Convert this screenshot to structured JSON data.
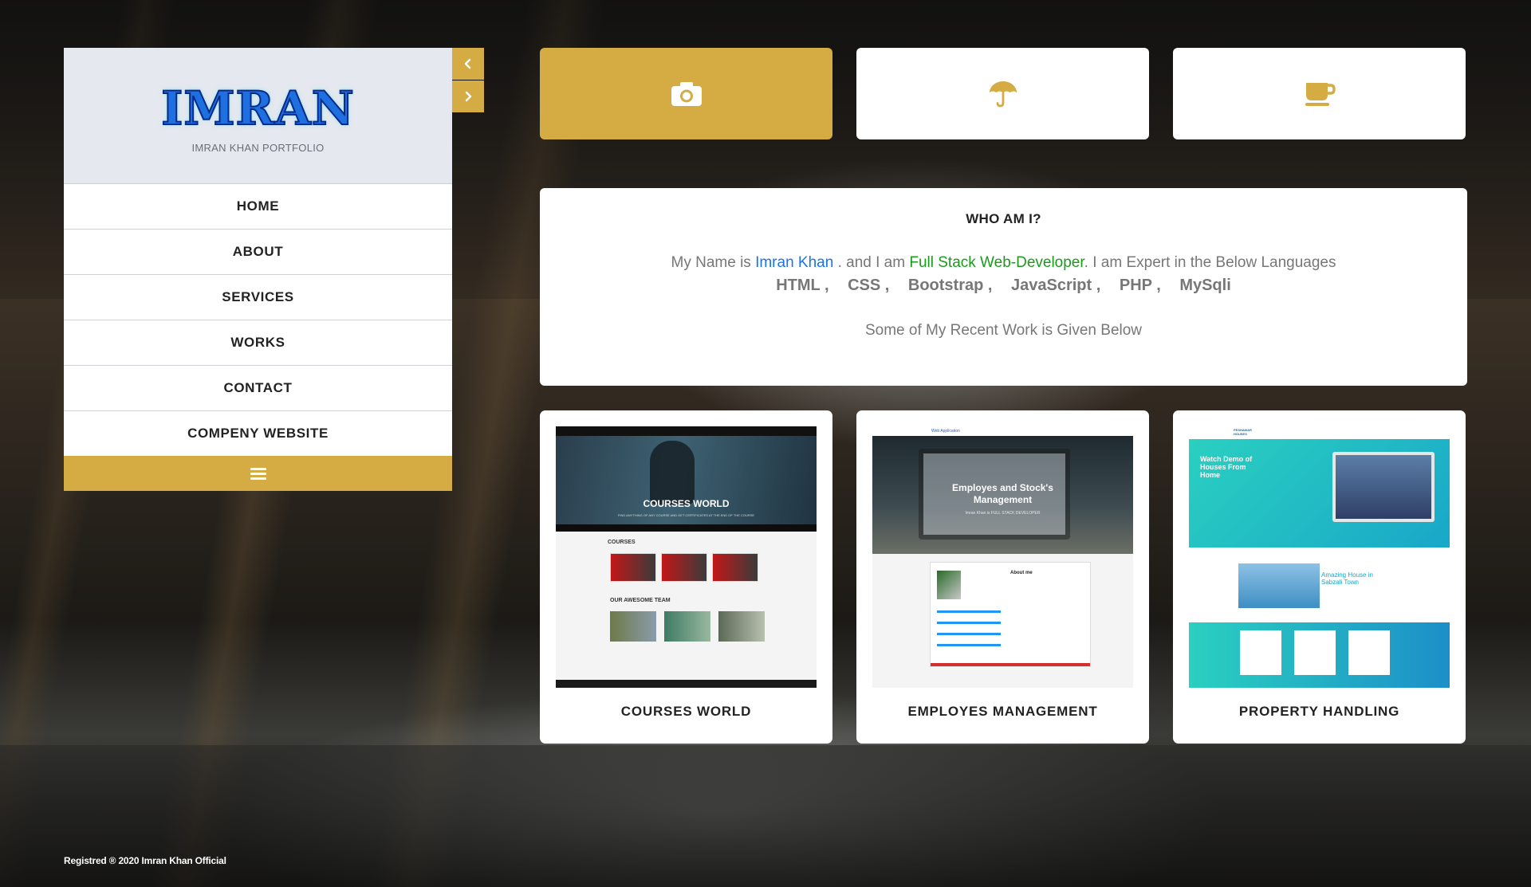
{
  "brand": {
    "logo_text": "IMRAN",
    "subtitle": "IMRAN KHAN PORTFOLIO"
  },
  "nav": {
    "items": [
      {
        "label": "HOME"
      },
      {
        "label": "ABOUT"
      },
      {
        "label": "SERVICES"
      },
      {
        "label": "WORKS"
      },
      {
        "label": "CONTACT"
      },
      {
        "label": "COMPENY WEBSITE"
      }
    ],
    "toggle_icon": "hamburger-icon",
    "prev_icon": "chevron-left-icon",
    "next_icon": "chevron-right-icon"
  },
  "tiles": [
    {
      "icon": "camera-icon",
      "active": true
    },
    {
      "icon": "umbrella-icon",
      "active": false
    },
    {
      "icon": "coffee-cup-icon",
      "active": false
    }
  ],
  "about": {
    "title": "WHO AM I?",
    "intro_prefix": "My Name is ",
    "name": "Imran Khan",
    "intro_mid": " . and I am ",
    "role": "Full Stack Web-Developer",
    "intro_suffix": ". I am Expert in the Below Languages",
    "languages": [
      "HTML ,",
      "CSS ,",
      "Bootstrap ,",
      "JavaScript ,",
      "PHP ,",
      "MySqli"
    ],
    "recent_text": "Some of My Recent Work is Given Below"
  },
  "works": [
    {
      "label": "COURSES WORLD",
      "shot": {
        "hero_title": "COURSES WORLD",
        "hero_caption": "FIND ANYTHING OF ANY COURSE AND GET CERTIFICATES AT THE END OF THE COURSE",
        "section_1": "COURSES",
        "section_2": "OUR AWESOME TEAM"
      }
    },
    {
      "label": "EMPLOYES MANAGEMENT",
      "shot": {
        "nav_title": "Web Application",
        "hero_title": "Employes and Stock's Management",
        "hero_caption": "Imran Khan is FULL STACK DEVELOPER",
        "section_1": "About me"
      }
    },
    {
      "label": "PROPERTY HANDLING",
      "shot": {
        "logo": "PESHAWAR HOUSES",
        "hero_title": "Watch Demo of Houses From Home",
        "section_1": "Amazing House in Sabzali Town"
      }
    }
  ],
  "footer": {
    "text": "Registred ® 2020 Imran Khan Official"
  },
  "colors": {
    "accent": "#d5ab44",
    "name_blue": "#1a73e8",
    "role_green": "#1c9a1c"
  }
}
